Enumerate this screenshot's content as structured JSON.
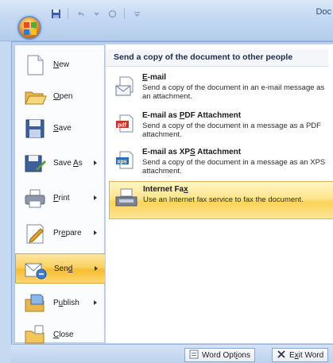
{
  "titlebar": {
    "title": "Doc",
    "orb_icon": "office-logo-icon",
    "qat": [
      "save-icon",
      "undo-icon",
      "redo-icon",
      "customize-icon"
    ]
  },
  "left_menu": {
    "items": [
      {
        "label_pre": "",
        "label_acc": "N",
        "label_post": "ew",
        "icon": "new-document-icon",
        "has_arrow": false
      },
      {
        "label_pre": "",
        "label_acc": "O",
        "label_post": "pen",
        "icon": "open-folder-icon",
        "has_arrow": false
      },
      {
        "label_pre": "",
        "label_acc": "S",
        "label_post": "ave",
        "icon": "save-icon",
        "has_arrow": false
      },
      {
        "label_pre": "Save ",
        "label_acc": "A",
        "label_post": "s",
        "icon": "save-as-icon",
        "has_arrow": true
      },
      {
        "label_pre": "",
        "label_acc": "P",
        "label_post": "rint",
        "icon": "printer-icon",
        "has_arrow": true
      },
      {
        "label_pre": "Pr",
        "label_acc": "e",
        "label_post": "pare",
        "icon": "prepare-icon",
        "has_arrow": true
      },
      {
        "label_pre": "Sen",
        "label_acc": "d",
        "label_post": "",
        "icon": "send-icon",
        "has_arrow": true,
        "active": true
      },
      {
        "label_pre": "P",
        "label_acc": "u",
        "label_post": "blish",
        "icon": "publish-icon",
        "has_arrow": true
      },
      {
        "label_pre": "",
        "label_acc": "C",
        "label_post": "lose",
        "icon": "close-folder-icon",
        "has_arrow": false
      }
    ]
  },
  "right_panel": {
    "header": "Send a copy of the document to other people",
    "options": [
      {
        "title_pre": "",
        "title_acc": "E",
        "title_post": "-mail",
        "desc": "Send a copy of the document in an e-mail message as an attachment.",
        "icon": "email-icon"
      },
      {
        "title_pre": "E-mail as ",
        "title_acc": "P",
        "title_post": "DF Attachment",
        "desc": "Send a copy of the document in a message as a PDF attachment.",
        "icon": "pdf-icon"
      },
      {
        "title_pre": "E-mail as XP",
        "title_acc": "S",
        "title_post": " Attachment",
        "desc": "Send a copy of the document in a message as an XPS attachment.",
        "icon": "xps-icon"
      },
      {
        "title_pre": "Internet Fa",
        "title_acc": "x",
        "title_post": "",
        "desc": "Use an Internet fax service to fax the document.",
        "icon": "fax-icon",
        "hover": true
      }
    ]
  },
  "bottom_bar": {
    "options_pre": "Word Opt",
    "options_acc": "i",
    "options_post": "ons",
    "exit_pre": "E",
    "exit_acc": "x",
    "exit_post": "it Word"
  },
  "colors": {
    "active_highlight": "#fbd161",
    "frame_blue": "#bdd1ee"
  }
}
